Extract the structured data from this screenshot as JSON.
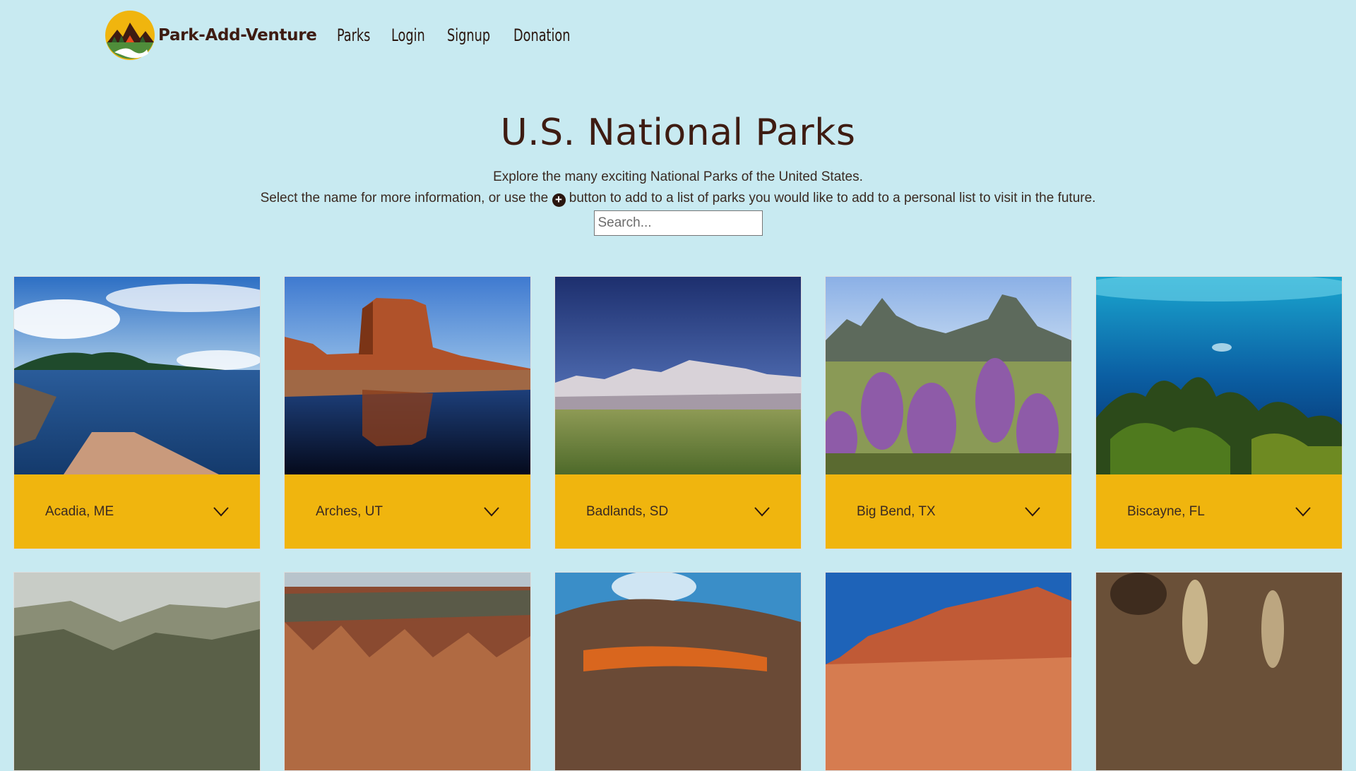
{
  "nav": {
    "brand": "Park-Add-Venture",
    "links": [
      "Parks",
      "Login",
      "Signup",
      "Donation"
    ]
  },
  "hero": {
    "title": "U.S. National Parks",
    "line1": "Explore the many exciting National Parks of the United States.",
    "line2_before": "Select the name for more information, or use the",
    "line2_after": "button to add to a list of parks you would like to add to a personal list to visit in the future.",
    "plus_icon": "+"
  },
  "search": {
    "placeholder": "Search..."
  },
  "parks": [
    {
      "name": "Acadia, ME"
    },
    {
      "name": "Arches, UT"
    },
    {
      "name": "Badlands, SD"
    },
    {
      "name": "Big Bend, TX"
    },
    {
      "name": "Biscayne, FL"
    }
  ],
  "colors": {
    "background": "#c8eaf1",
    "card_footer": "#f0b50e",
    "text_dark": "#3e1c12"
  }
}
